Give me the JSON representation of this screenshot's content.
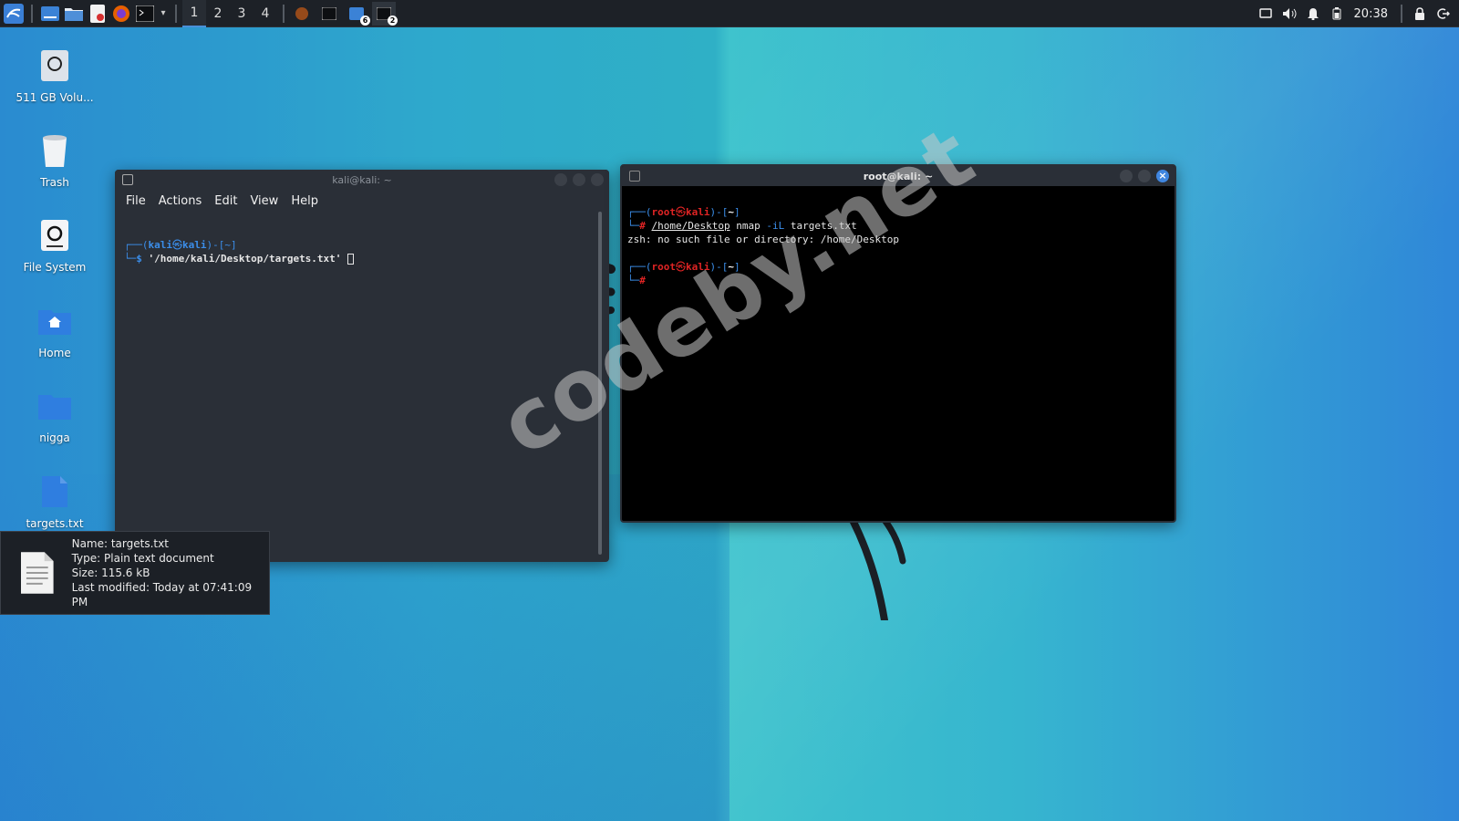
{
  "taskbar": {
    "workspaces": [
      "1",
      "2",
      "3",
      "4"
    ],
    "active_workspace": "1",
    "badge_a": "6",
    "badge_b": "2",
    "time": "20:38"
  },
  "desktop_icons": [
    {
      "label": "511 GB Volu..."
    },
    {
      "label": "Trash"
    },
    {
      "label": "File System"
    },
    {
      "label": "Home"
    },
    {
      "label": "nigga"
    },
    {
      "label": "targets.txt"
    }
  ],
  "window_kali": {
    "title": "kali@kali: ~",
    "menu": [
      "File",
      "Actions",
      "Edit",
      "View",
      "Help"
    ],
    "prompt_open": "┌──(",
    "user": "kali",
    "at": "㉿",
    "host": "kali",
    "dir_part": ")-[~]",
    "line2_prefix": "└─",
    "dollar": "$ ",
    "command": "'/home/kali/Desktop/targets.txt'"
  },
  "window_root": {
    "title": "root@kali: ~",
    "prompt_open": "┌──(",
    "user": "root",
    "at": "㉿",
    "host": "kali",
    "close_part": ")-[",
    "dir": "~",
    "close_bracket": "]",
    "line2_prefix": "└─",
    "hash": "# ",
    "cmd_path": "/home/Desktop",
    "cmd_rest_1": " nmap ",
    "cmd_flag": "-iL",
    "cmd_rest_2": " targets.txt",
    "error": "zsh: no such file or directory: /home/Desktop"
  },
  "tooltip": {
    "name": "Name: targets.txt",
    "type": "Type: Plain text document",
    "size": "Size: 115.6 kB",
    "modified": "Last modified: Today at 07:41:09 PM"
  },
  "watermark": "codeby.net",
  "colors": {
    "prompt_blue": "#3b8eea",
    "prompt_red": "#e02424",
    "terminal_bg": "#000000",
    "kali_term_bg": "#2a2f37",
    "accent": "#4a90d9"
  }
}
